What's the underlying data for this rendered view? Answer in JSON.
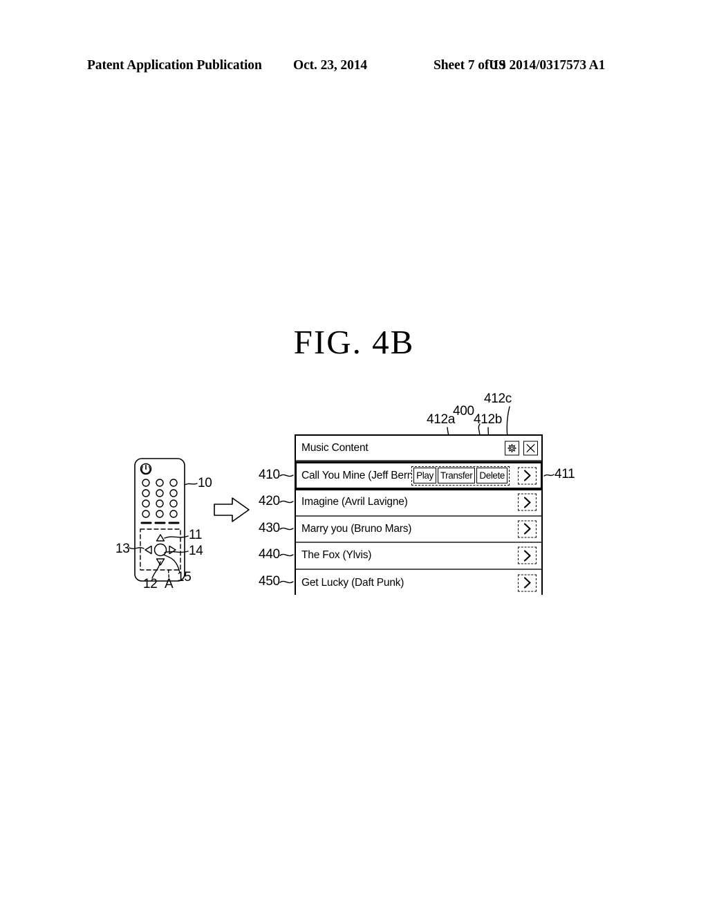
{
  "header": {
    "publication": "Patent Application Publication",
    "date": "Oct. 23, 2014",
    "sheet": "Sheet 7 of 19",
    "patent_number": "US 2014/0317573 A1"
  },
  "figure": {
    "title": "FIG.  4B"
  },
  "panel": {
    "ref": "400",
    "title": "Music Content",
    "settings_icon": "gear-icon",
    "close_icon": "close-x-icon",
    "rows": [
      {
        "ref": "410",
        "title": "Call You Mine (Jeff Bernat)",
        "selected": true,
        "chevron_ref": "411",
        "actions": [
          {
            "label": "Play",
            "ref": "412a"
          },
          {
            "label": "Transfer",
            "ref": "412b"
          },
          {
            "label": "Delete",
            "ref": "412c"
          }
        ]
      },
      {
        "ref": "420",
        "title": "Imagine (Avril Lavigne)",
        "selected": false
      },
      {
        "ref": "430",
        "title": "Marry you (Bruno Mars)",
        "selected": false
      },
      {
        "ref": "440",
        "title": "The Fox (Ylvis)",
        "selected": false
      },
      {
        "ref": "450",
        "title": "Get Lucky (Daft Punk)",
        "selected": false
      }
    ]
  },
  "remote": {
    "ref_body": "10",
    "ref_up": "11",
    "ref_down": "12",
    "ref_left": "13",
    "ref_right": "14",
    "ref_center": "15",
    "ref_region": "A",
    "power_icon": "power-icon"
  },
  "callouts": {
    "panel": "400",
    "chevron": "411",
    "play": "412a",
    "transfer": "412b",
    "delete": "412c"
  }
}
